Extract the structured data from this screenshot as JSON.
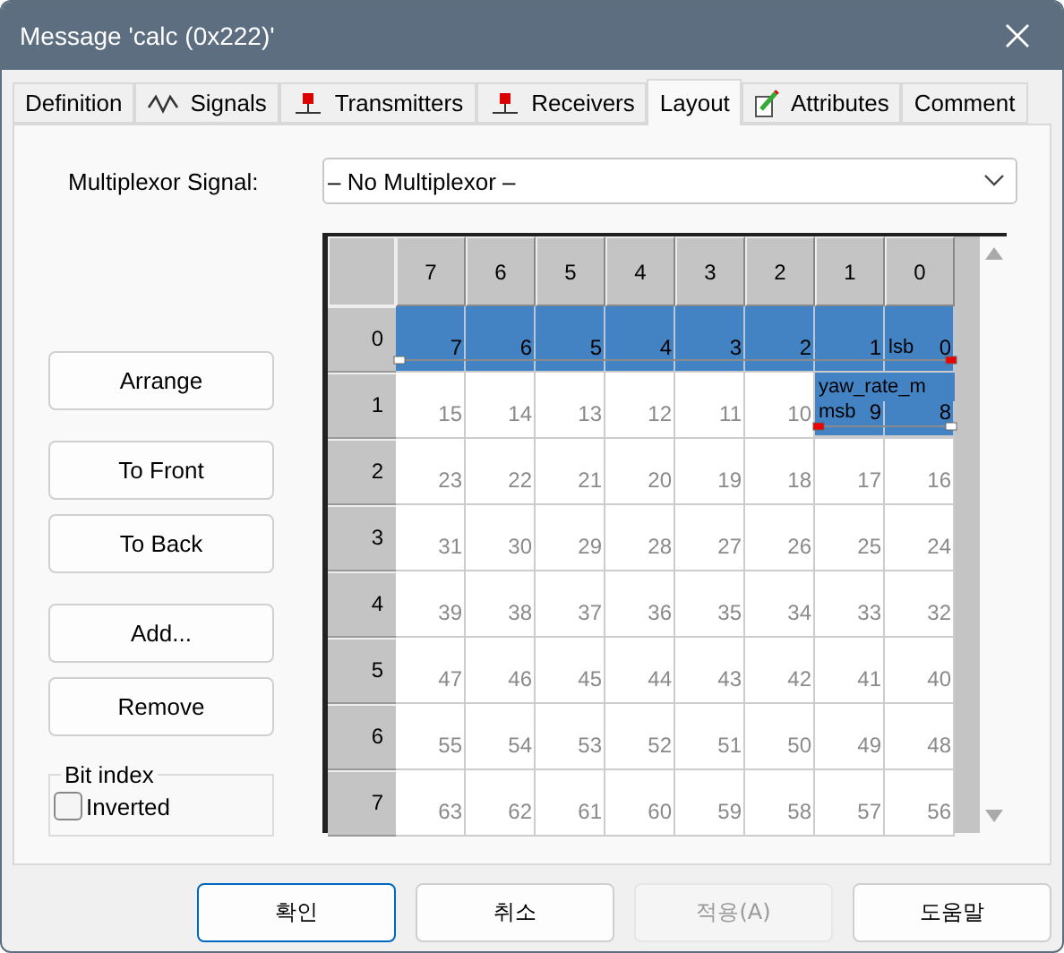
{
  "window": {
    "title": "Message 'calc (0x222)'"
  },
  "tabs": [
    {
      "label": "Definition",
      "kind": "plain",
      "selected": false
    },
    {
      "label": "Signals",
      "kind": "wave",
      "selected": false
    },
    {
      "label": "Transmitters",
      "kind": "node",
      "selected": false
    },
    {
      "label": "Receivers",
      "kind": "node",
      "selected": false
    },
    {
      "label": "Layout",
      "kind": "plain",
      "selected": true
    },
    {
      "label": "Attributes",
      "kind": "pencil",
      "selected": false
    },
    {
      "label": "Comment",
      "kind": "plain",
      "selected": false
    }
  ],
  "multiplexor": {
    "label": "Multiplexor Signal:",
    "value": "– No Multiplexor –"
  },
  "side_buttons": [
    "Arrange",
    "To Front",
    "To Back",
    "Add...",
    "Remove"
  ],
  "bit_index": {
    "title": "Bit index",
    "option": {
      "label": "Inverted",
      "checked": false
    }
  },
  "layout_grid": {
    "columns": [
      "7",
      "6",
      "5",
      "4",
      "3",
      "2",
      "1",
      "0"
    ],
    "rows": [
      {
        "byte": "0",
        "cells": [
          {
            "bit": "7",
            "filled": true
          },
          {
            "bit": "6",
            "filled": true
          },
          {
            "bit": "5",
            "filled": true
          },
          {
            "bit": "4",
            "filled": true
          },
          {
            "bit": "3",
            "filled": true
          },
          {
            "bit": "2",
            "filled": true
          },
          {
            "bit": "1",
            "filled": true
          },
          {
            "bit": "0",
            "filled": true,
            "tag": "lsb"
          }
        ]
      },
      {
        "byte": "1",
        "cells": [
          {
            "bit": "15",
            "filled": false
          },
          {
            "bit": "14",
            "filled": false
          },
          {
            "bit": "13",
            "filled": false
          },
          {
            "bit": "12",
            "filled": false
          },
          {
            "bit": "11",
            "filled": false
          },
          {
            "bit": "10",
            "filled": false
          },
          {
            "bit": "9",
            "filled": true,
            "tag": "msb"
          },
          {
            "bit": "8",
            "filled": true
          }
        ],
        "signal_name": "yaw_rate_m"
      },
      {
        "byte": "2",
        "cells": [
          {
            "bit": "23",
            "filled": false
          },
          {
            "bit": "22",
            "filled": false
          },
          {
            "bit": "21",
            "filled": false
          },
          {
            "bit": "20",
            "filled": false
          },
          {
            "bit": "19",
            "filled": false
          },
          {
            "bit": "18",
            "filled": false
          },
          {
            "bit": "17",
            "filled": false
          },
          {
            "bit": "16",
            "filled": false
          }
        ]
      },
      {
        "byte": "3",
        "cells": [
          {
            "bit": "31",
            "filled": false
          },
          {
            "bit": "30",
            "filled": false
          },
          {
            "bit": "29",
            "filled": false
          },
          {
            "bit": "28",
            "filled": false
          },
          {
            "bit": "27",
            "filled": false
          },
          {
            "bit": "26",
            "filled": false
          },
          {
            "bit": "25",
            "filled": false
          },
          {
            "bit": "24",
            "filled": false
          }
        ]
      },
      {
        "byte": "4",
        "cells": [
          {
            "bit": "39",
            "filled": false
          },
          {
            "bit": "38",
            "filled": false
          },
          {
            "bit": "37",
            "filled": false
          },
          {
            "bit": "36",
            "filled": false
          },
          {
            "bit": "35",
            "filled": false
          },
          {
            "bit": "34",
            "filled": false
          },
          {
            "bit": "33",
            "filled": false
          },
          {
            "bit": "32",
            "filled": false
          }
        ]
      },
      {
        "byte": "5",
        "cells": [
          {
            "bit": "47",
            "filled": false
          },
          {
            "bit": "46",
            "filled": false
          },
          {
            "bit": "45",
            "filled": false
          },
          {
            "bit": "44",
            "filled": false
          },
          {
            "bit": "43",
            "filled": false
          },
          {
            "bit": "42",
            "filled": false
          },
          {
            "bit": "41",
            "filled": false
          },
          {
            "bit": "40",
            "filled": false
          }
        ]
      },
      {
        "byte": "6",
        "cells": [
          {
            "bit": "55",
            "filled": false
          },
          {
            "bit": "54",
            "filled": false
          },
          {
            "bit": "53",
            "filled": false
          },
          {
            "bit": "52",
            "filled": false
          },
          {
            "bit": "51",
            "filled": false
          },
          {
            "bit": "50",
            "filled": false
          },
          {
            "bit": "49",
            "filled": false
          },
          {
            "bit": "48",
            "filled": false
          }
        ]
      },
      {
        "byte": "7",
        "cells": [
          {
            "bit": "63",
            "filled": false
          },
          {
            "bit": "62",
            "filled": false
          },
          {
            "bit": "61",
            "filled": false
          },
          {
            "bit": "60",
            "filled": false
          },
          {
            "bit": "59",
            "filled": false
          },
          {
            "bit": "58",
            "filled": false
          },
          {
            "bit": "57",
            "filled": false
          },
          {
            "bit": "56",
            "filled": false
          }
        ]
      }
    ]
  },
  "dialog_buttons": [
    {
      "label": "확인",
      "default": true,
      "disabled": false
    },
    {
      "label": "취소",
      "default": false,
      "disabled": false
    },
    {
      "label": "적용(A)",
      "default": false,
      "disabled": true
    },
    {
      "label": "도움말",
      "default": false,
      "disabled": false
    }
  ]
}
